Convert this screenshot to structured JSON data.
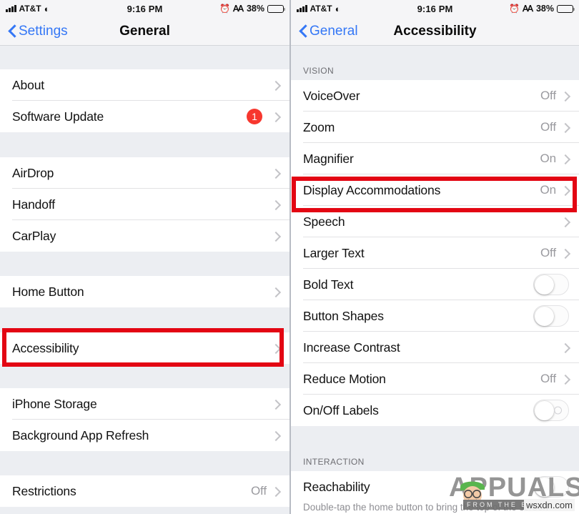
{
  "status_bar": {
    "carrier": "AT&T",
    "signal_icon": "signal-bars-icon",
    "wifi_icon": "wifi-icon",
    "time": "9:16 PM",
    "alarm_icon": "alarm-clock-icon",
    "bluetooth_icon": "bluetooth-icon",
    "battery_percent": "38%",
    "battery_icon": "battery-icon"
  },
  "left_panel": {
    "nav": {
      "back_label": "Settings",
      "back_icon": "chevron-left-icon",
      "title": "General"
    },
    "groups": [
      {
        "rows": [
          {
            "label": "About",
            "value": "",
            "accessory": "chevron"
          },
          {
            "label": "Software Update",
            "value": "",
            "accessory": "badge",
            "badge": "1"
          }
        ]
      },
      {
        "rows": [
          {
            "label": "AirDrop",
            "value": "",
            "accessory": "chevron"
          },
          {
            "label": "Handoff",
            "value": "",
            "accessory": "chevron"
          },
          {
            "label": "CarPlay",
            "value": "",
            "accessory": "chevron"
          }
        ]
      },
      {
        "rows": [
          {
            "label": "Home Button",
            "value": "",
            "accessory": "chevron"
          }
        ]
      },
      {
        "highlighted": true,
        "rows": [
          {
            "label": "Accessibility",
            "value": "",
            "accessory": "chevron"
          }
        ]
      },
      {
        "rows": [
          {
            "label": "iPhone Storage",
            "value": "",
            "accessory": "chevron"
          },
          {
            "label": "Background App Refresh",
            "value": "",
            "accessory": "chevron"
          }
        ]
      },
      {
        "rows": [
          {
            "label": "Restrictions",
            "value": "Off",
            "accessory": "chevron"
          }
        ]
      }
    ]
  },
  "right_panel": {
    "nav": {
      "back_label": "General",
      "back_icon": "chevron-left-icon",
      "title": "Accessibility"
    },
    "sections": [
      {
        "header": "VISION",
        "rows": [
          {
            "label": "VoiceOver",
            "value": "Off",
            "accessory": "chevron"
          },
          {
            "label": "Zoom",
            "value": "Off",
            "accessory": "chevron"
          },
          {
            "label": "Magnifier",
            "value": "On",
            "accessory": "chevron"
          },
          {
            "label": "Display Accommodations",
            "value": "On",
            "accessory": "chevron",
            "highlighted": true
          },
          {
            "label": "Speech",
            "value": "",
            "accessory": "chevron"
          },
          {
            "label": "Larger Text",
            "value": "Off",
            "accessory": "chevron"
          },
          {
            "label": "Bold Text",
            "value": "",
            "accessory": "toggle",
            "toggle_state": "off"
          },
          {
            "label": "Button Shapes",
            "value": "",
            "accessory": "toggle",
            "toggle_state": "off"
          },
          {
            "label": "Increase Contrast",
            "value": "",
            "accessory": "chevron"
          },
          {
            "label": "Reduce Motion",
            "value": "Off",
            "accessory": "chevron"
          },
          {
            "label": "On/Off Labels",
            "value": "",
            "accessory": "toggle-labeled",
            "toggle_state": "off"
          }
        ]
      },
      {
        "header": "INTERACTION",
        "rows": [
          {
            "label": "Reachability",
            "value": "",
            "accessory": "toggle",
            "toggle_state": "off"
          }
        ],
        "footer": "Double-tap the home button to bring the top of the screen"
      }
    ]
  },
  "watermark": {
    "brand": "APPUALS",
    "tagline": "FROM THE EXPERTS",
    "domain": "wsxdn.com"
  },
  "colors": {
    "accent_blue": "#3477f6",
    "highlight_red": "#e30613",
    "badge_red": "#f7372e",
    "group_bg": "#ffffff",
    "page_bg": "#eceef2"
  }
}
